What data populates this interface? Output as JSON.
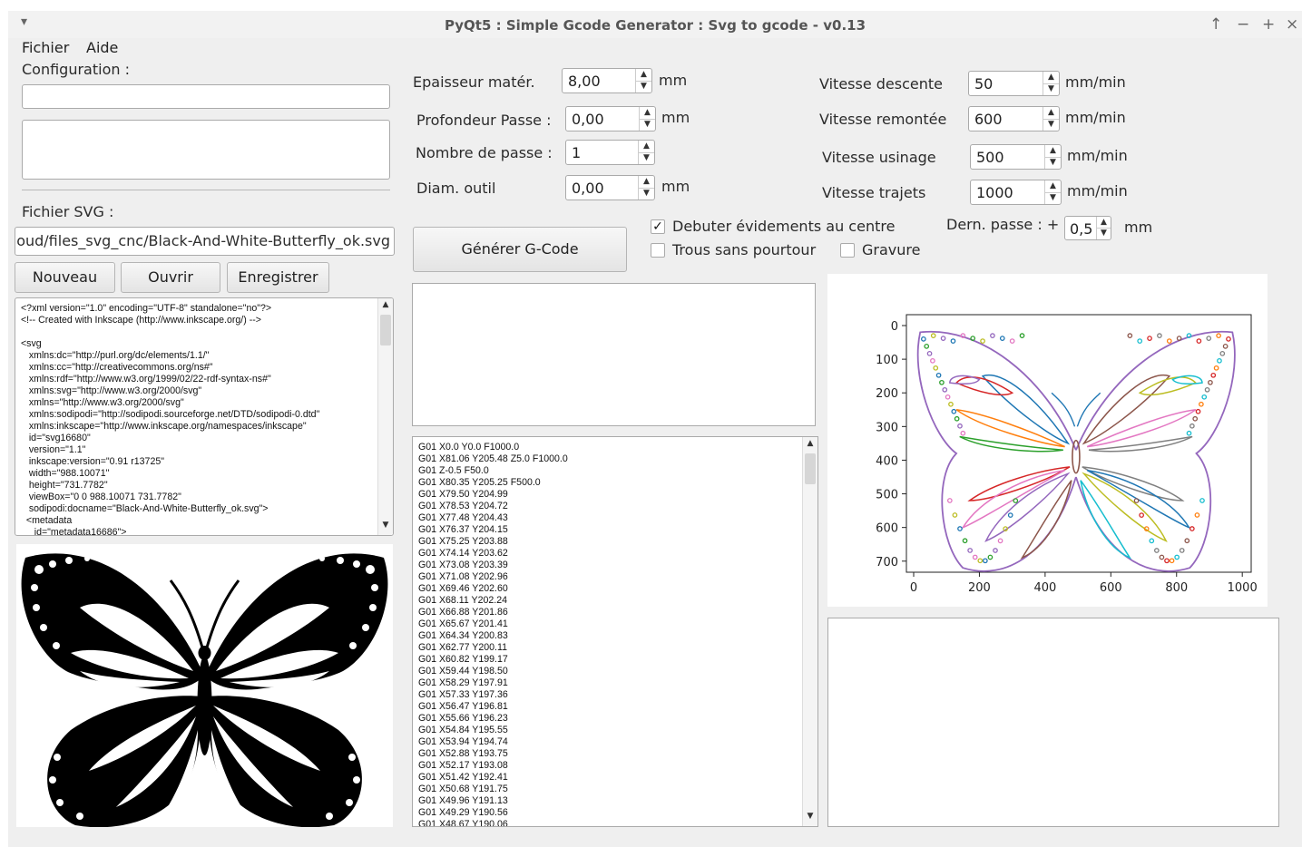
{
  "window": {
    "title": "PyQt5 : Simple Gcode Generator : Svg to gcode - v0.13",
    "menu_glyph": "▾",
    "controls": {
      "up": "↑",
      "min": "−",
      "max": "+",
      "close": "×"
    }
  },
  "menu": {
    "file": "Fichier",
    "help": "Aide"
  },
  "left": {
    "config_label": "Configuration :",
    "config_value": "",
    "config_notes": "",
    "svg_label": "Fichier SVG :",
    "svg_path": "Cloud/files_svg_cnc/Black-And-White-Butterfly_ok.svg",
    "buttons": {
      "new": "Nouveau",
      "open": "Ouvrir",
      "save": "Enregistrer"
    },
    "svg_source": "<?xml version=\"1.0\" encoding=\"UTF-8\" standalone=\"no\"?>\n<!-- Created with Inkscape (http://www.inkscape.org/) -->\n\n<svg\n   xmlns:dc=\"http://purl.org/dc/elements/1.1/\"\n   xmlns:cc=\"http://creativecommons.org/ns#\"\n   xmlns:rdf=\"http://www.w3.org/1999/02/22-rdf-syntax-ns#\"\n   xmlns:svg=\"http://www.w3.org/2000/svg\"\n   xmlns=\"http://www.w3.org/2000/svg\"\n   xmlns:sodipodi=\"http://sodipodi.sourceforge.net/DTD/sodipodi-0.dtd\"\n   xmlns:inkscape=\"http://www.inkscape.org/namespaces/inkscape\"\n   id=\"svg16680\"\n   version=\"1.1\"\n   inkscape:version=\"0.91 r13725\"\n   width=\"988.10071\"\n   height=\"731.7782\"\n   viewBox=\"0 0 988.10071 731.7782\"\n   sodipodi:docname=\"Black-And-White-Butterfly_ok.svg\">\n  <metadata\n     id=\"metadata16686\">"
  },
  "params": {
    "thickness": {
      "label": "Epaisseur matér.",
      "value": "8,00",
      "unit": "mm"
    },
    "pass_depth": {
      "label": "Profondeur Passe :",
      "value": "0,00",
      "unit": "mm"
    },
    "pass_count": {
      "label": "Nombre de passe :",
      "value": "1"
    },
    "tool_diam": {
      "label": "Diam. outil",
      "value": "0,00",
      "unit": "mm"
    },
    "speed_down": {
      "label": "Vitesse descente",
      "value": "50",
      "unit": "mm/min"
    },
    "speed_up": {
      "label": "Vitesse remontée",
      "value": "600",
      "unit": "mm/min"
    },
    "speed_mill": {
      "label": "Vitesse usinage",
      "value": "500",
      "unit": "mm/min"
    },
    "speed_travel": {
      "label": "Vitesse trajets",
      "value": "1000",
      "unit": "mm/min"
    },
    "center_start": {
      "label": "Debuter évidements au centre",
      "checked": true
    },
    "holes_no_contour": {
      "label": "Trous sans pourtour",
      "checked": false
    },
    "engraving": {
      "label": "Gravure",
      "checked": false
    },
    "last_pass": {
      "label": "Dern. passe : +",
      "value": "0,5",
      "unit": "mm"
    }
  },
  "generate_button": "Générer G-Code",
  "gcode_lines": [
    "G01 X0.0 Y0.0 F1000.0",
    "G01 X81.06 Y205.48 Z5.0 F1000.0",
    "G01 Z-0.5 F50.0",
    "G01 X80.35 Y205.25 F500.0",
    "G01 X79.50 Y204.99",
    "G01 X78.53 Y204.72",
    "G01 X77.48 Y204.43",
    "G01 X76.37 Y204.15",
    "G01 X75.25 Y203.88",
    "G01 X74.14 Y203.62",
    "G01 X73.08 Y203.39",
    "G01 X71.08 Y202.96",
    "G01 X69.46 Y202.60",
    "G01 X68.11 Y202.24",
    "G01 X66.88 Y201.86",
    "G01 X65.67 Y201.41",
    "G01 X64.34 Y200.83",
    "G01 X62.77 Y200.11",
    "G01 X60.82 Y199.17",
    "G01 X59.44 Y198.50",
    "G01 X58.29 Y197.91",
    "G01 X57.33 Y197.36",
    "G01 X56.47 Y196.81",
    "G01 X55.66 Y196.23",
    "G01 X54.84 Y195.55",
    "G01 X53.94 Y194.74",
    "G01 X52.88 Y193.75",
    "G01 X52.17 Y193.08",
    "G01 X51.42 Y192.41",
    "G01 X50.68 Y191.75",
    "G01 X49.96 Y191.13",
    "G01 X49.29 Y190.56",
    "G01 X48.67 Y190.06"
  ],
  "plot": {
    "x_ticks": [
      "0",
      "200",
      "400",
      "600",
      "800",
      "1000"
    ],
    "y_ticks": [
      "0",
      "100",
      "200",
      "300",
      "400",
      "500",
      "600",
      "700"
    ],
    "palette": [
      "#1f77b4",
      "#ff7f0e",
      "#2ca02c",
      "#d62728",
      "#9467bd",
      "#8c564b",
      "#e377c2",
      "#7f7f7f",
      "#bcbd22",
      "#17becf"
    ]
  }
}
